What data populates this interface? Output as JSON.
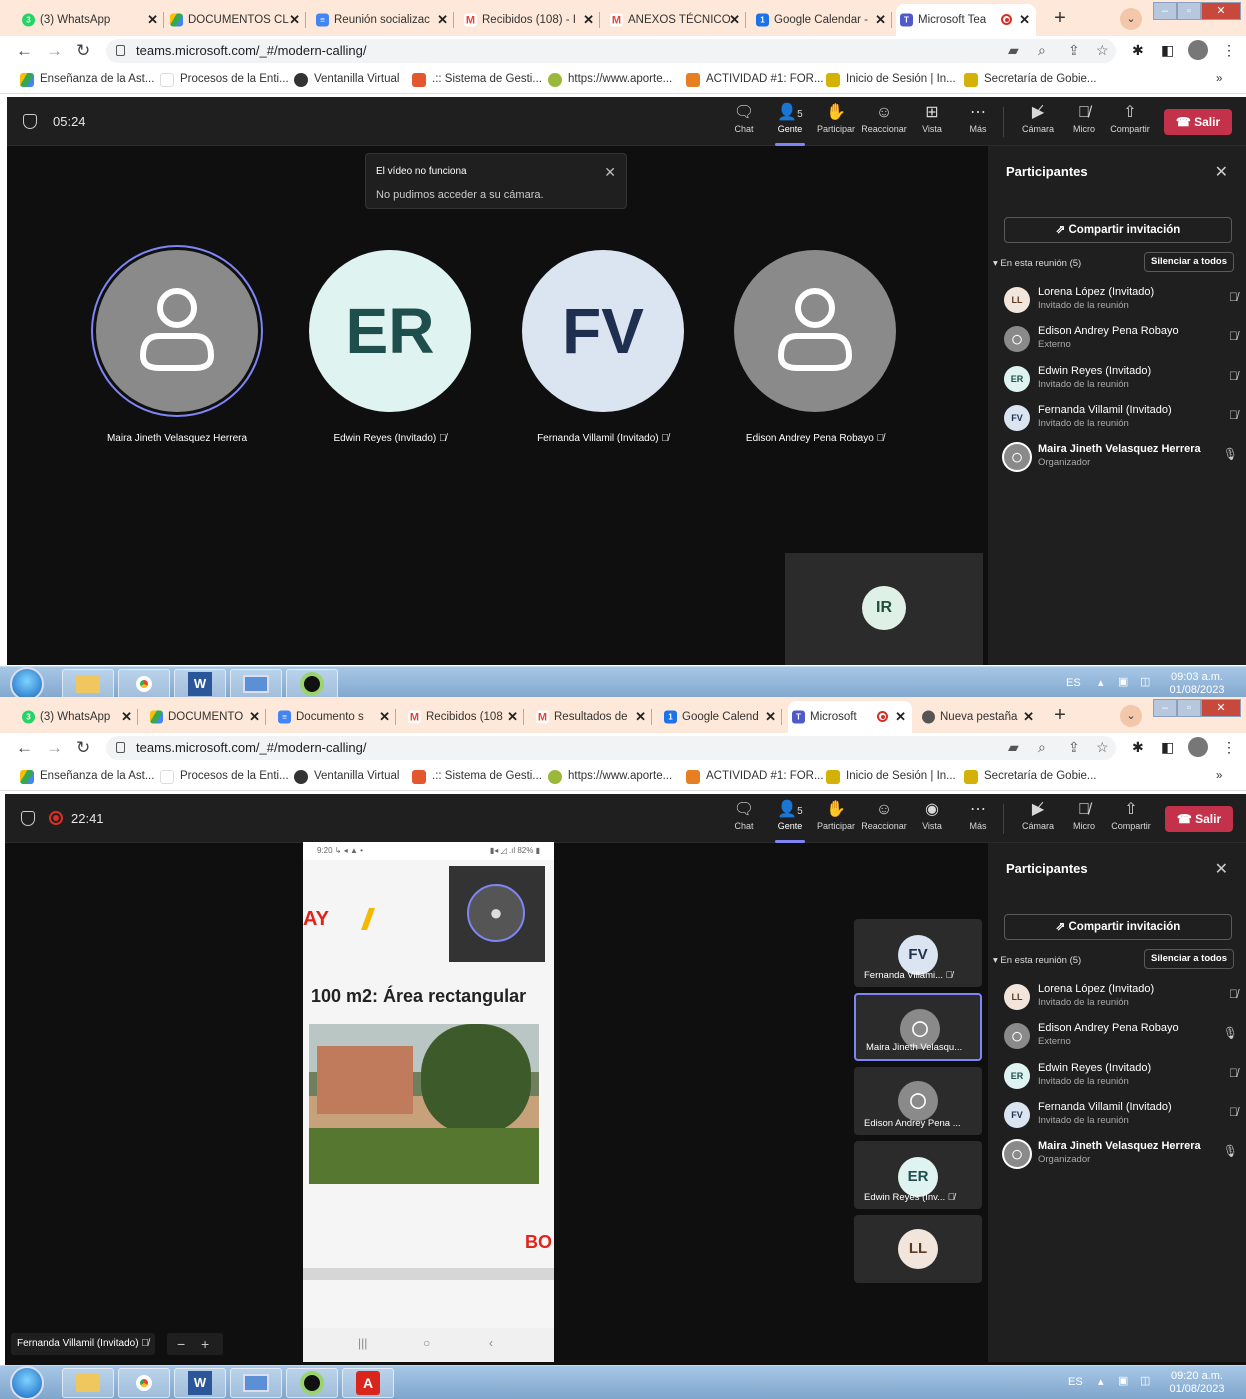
{
  "shot1": {
    "tabs": [
      "(3) WhatsApp",
      "DOCUMENTOS CL",
      "Reunión socializac",
      "Recibidos (108) - I",
      "ANEXOS TÉCNICO",
      "Google Calendar -",
      "Microsoft Tea"
    ],
    "url": "teams.microsoft.com/_#/modern-calling/",
    "timer": "05:24",
    "toast": {
      "title": "El vídeo no funciona",
      "body": "No pudimos acceder a su cámara."
    },
    "stage": [
      {
        "name": "Maira Jineth Velasquez Herrera",
        "initials": ""
      },
      {
        "name": "Edwin Reyes (Invitado)",
        "initials": "ER"
      },
      {
        "name": "Fernanda Villamil (Invitado)",
        "initials": "FV"
      },
      {
        "name": "Edison Andrey Pena Robayo",
        "initials": ""
      }
    ],
    "self_initials": "IR",
    "clock": {
      "time": "09:03 a.m.",
      "date": "01/08/2023"
    }
  },
  "shot2": {
    "tabs": [
      "(3) WhatsApp",
      "DOCUMENTO",
      "Documento s",
      "Recibidos (108",
      "Resultados de",
      "Google Calend",
      "Microsoft",
      "Nueva pestaña"
    ],
    "url": "teams.microsoft.com/_#/modern-calling/",
    "timer": "22:41",
    "phone": {
      "status_time": "9:20",
      "battery": "82%",
      "heading": "100 m2:  Área rectangular",
      "brand_left": "AY",
      "brand_right": "BO"
    },
    "tiles": [
      {
        "name": "Fernanda Villami...",
        "initials": "FV"
      },
      {
        "name": "Maira Jineth Velasqu...",
        "initials": ""
      },
      {
        "name": "Edison Andrey Pena ...",
        "initials": ""
      },
      {
        "name": "Edwin Reyes (Inv...",
        "initials": "ER"
      },
      {
        "name": "",
        "initials": "LL"
      }
    ],
    "presenter": "Fernanda Villamil (Invitado)",
    "clock": {
      "time": "09:20 a.m.",
      "date": "01/08/2023"
    }
  },
  "bookmarks": [
    "Enseñanza de la Ast...",
    "Procesos de la Enti...",
    "Ventanilla Virtual",
    ".:: Sistema de Gesti...",
    "https://www.aporte...",
    "ACTIVIDAD #1: FOR...",
    "Inicio de Sesión | In...",
    "Secretaría de Gobie..."
  ],
  "toolbar": {
    "chat": "Chat",
    "people": "Gente",
    "people_count": "5",
    "raise": "Participar",
    "react": "Reaccionar",
    "view": "Vista",
    "more": "Más",
    "camera": "Cámara",
    "mic": "Micro",
    "share": "Compartir",
    "leave": "Salir"
  },
  "panel": {
    "title": "Participantes",
    "invite": "Compartir invitación",
    "in_meeting": "En esta reunión (5)",
    "mute_all": "Silenciar a todos",
    "people": [
      {
        "initials": "LL",
        "name": "Lorena López (Invitado)",
        "role": "Invitado de la reunión"
      },
      {
        "initials": "",
        "name": "Edison Andrey Pena Robayo",
        "role": "Externo"
      },
      {
        "initials": "ER",
        "name": "Edwin Reyes (Invitado)",
        "role": "Invitado de la reunión"
      },
      {
        "initials": "FV",
        "name": "Fernanda Villamil (Invitado)",
        "role": "Invitado de la reunión"
      },
      {
        "initials": "",
        "name": "Maira Jineth Velasquez Herrera",
        "role": "Organizador"
      }
    ]
  },
  "lang": "ES",
  "colors": {
    "accent": "#7f85f5",
    "leave": "#c4314b",
    "tab_bar": "#fde8d9",
    "er_avatar": "#dff3f0",
    "fv_avatar": "#dbe5f1",
    "ll_avatar": "#f2e6dc"
  }
}
